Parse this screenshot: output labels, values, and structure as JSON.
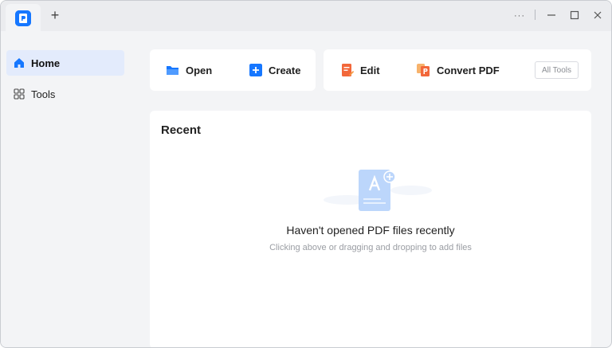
{
  "titlebar": {
    "app_icon": "pdf-app-logo-icon",
    "new_tab_label": "+",
    "more_label": "···",
    "minimize_label": "—",
    "maximize_label": "☐",
    "close_label": "✕"
  },
  "sidebar": {
    "items": [
      {
        "label": "Home",
        "icon": "home-icon",
        "active": true
      },
      {
        "label": "Tools",
        "icon": "grid-icon",
        "active": false
      }
    ]
  },
  "quick_actions": {
    "open_label": "Open",
    "create_label": "Create",
    "edit_label": "Edit",
    "convert_label": "Convert PDF",
    "all_tools_label": "All Tools"
  },
  "recent": {
    "title": "Recent",
    "empty_title": "Haven't opened PDF files recently",
    "empty_subtitle": "Clicking above or dragging and dropping to add files"
  },
  "colors": {
    "accent": "#1677ff",
    "active_nav_bg": "#e3ebfc",
    "edit_icon": "#f2673a",
    "convert_icon": "#f59a42",
    "empty_illustration": "#bcd6fb"
  }
}
